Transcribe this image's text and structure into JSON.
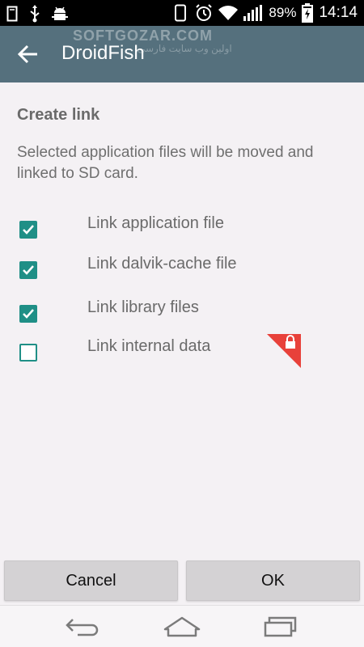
{
  "status_bar": {
    "battery": "89%",
    "time": "14:14"
  },
  "action_bar": {
    "title": "DroidFish",
    "watermark": "SOFTGOZAR.COM",
    "watermark_sub": "اولین وب سایت فارسی"
  },
  "dialog": {
    "title": "Create link",
    "message": "Selected application files will be moved and linked to SD card."
  },
  "options": [
    {
      "label": "Link application file",
      "checked": true
    },
    {
      "label": "Link dalvik-cache file",
      "checked": true
    },
    {
      "label": "Link library files",
      "checked": true
    },
    {
      "label": "Link internal data",
      "checked": false,
      "locked": true
    }
  ],
  "buttons": {
    "cancel": "Cancel",
    "ok": "OK"
  },
  "colors": {
    "action_bar": "#55707d",
    "checkbox_accent": "#1f8f86",
    "lock_badge": "#e8413a"
  }
}
